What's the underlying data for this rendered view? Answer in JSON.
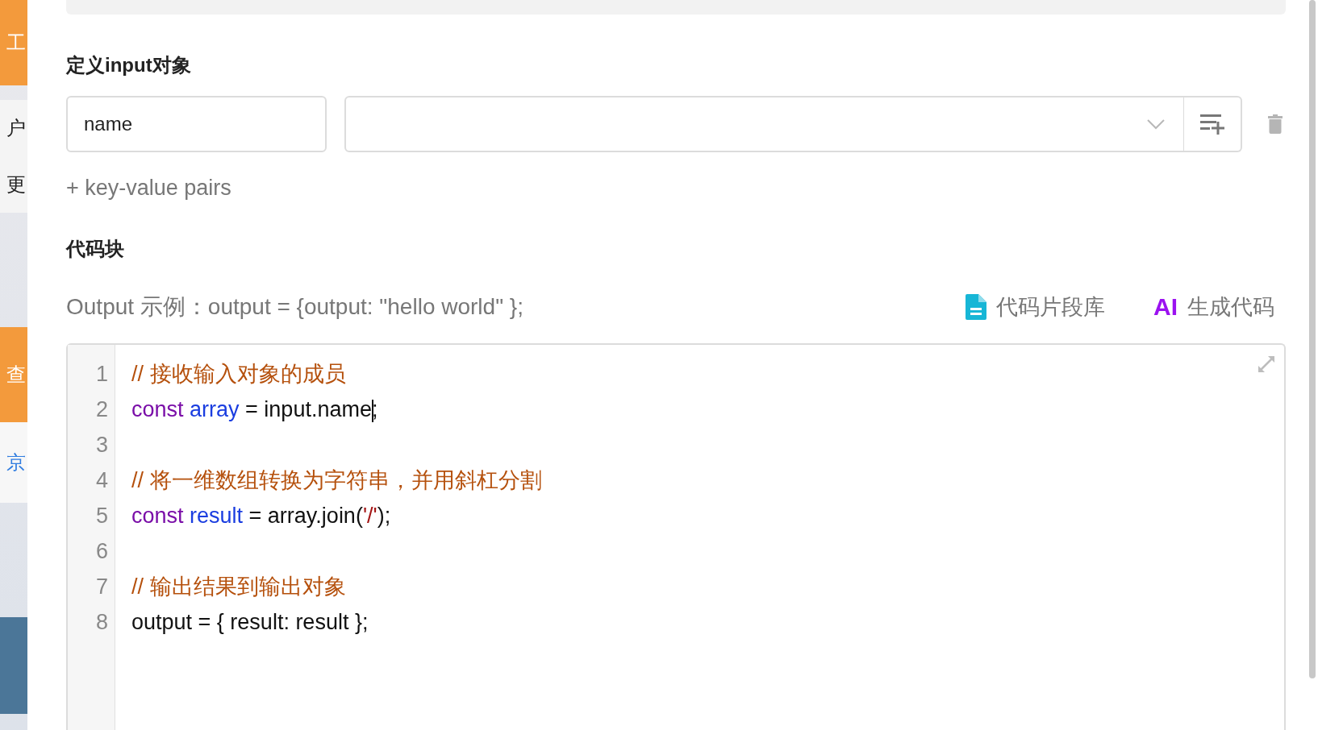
{
  "side_strip": [
    {
      "text": "工",
      "kind": "accent"
    },
    {
      "text": "户",
      "kind": "plain"
    },
    {
      "text": "更",
      "kind": "plain"
    },
    {
      "text": "查",
      "kind": "accent"
    },
    {
      "text": "京",
      "kind": "link"
    },
    {
      "kind": "dark"
    }
  ],
  "input_section": {
    "title": "定义input对象",
    "rows": [
      {
        "key": "name"
      }
    ],
    "add_link": "+ key-value pairs"
  },
  "code_section": {
    "title": "代码块",
    "hint": "Output 示例：output = {output: \"hello world\" };",
    "snippet_button": "代码片段库",
    "ai_badge": "AI",
    "ai_button": "生成代码",
    "lines": [
      {
        "number": "1",
        "tokens": [
          {
            "kind": "comment",
            "text": "// 接收输入对象的成员"
          }
        ]
      },
      {
        "number": "2",
        "tokens": [
          {
            "kind": "keyword",
            "text": "const"
          },
          {
            "kind": "variable",
            "text": " array"
          },
          {
            "kind": "plain",
            "text": " = input.name",
            "cursor_after": true
          },
          {
            "kind": "plain",
            "text": ";"
          }
        ]
      },
      {
        "number": "3"
      },
      {
        "number": "4",
        "tokens": [
          {
            "kind": "comment",
            "text": "// 将一维数组转换为字符串，并用斜杠分割"
          }
        ]
      },
      {
        "number": "5",
        "tokens": [
          {
            "kind": "keyword",
            "text": "const"
          },
          {
            "kind": "variable",
            "text": " result"
          },
          {
            "kind": "plain",
            "text": " = array.join("
          },
          {
            "kind": "string",
            "text": "'/'"
          },
          {
            "kind": "plain",
            "text": ");"
          }
        ]
      },
      {
        "number": "6"
      },
      {
        "number": "7",
        "tokens": [
          {
            "kind": "comment",
            "text": "// 输出结果到输出对象"
          }
        ]
      },
      {
        "number": "8",
        "tokens": [
          {
            "kind": "plain",
            "text": "output = { result: result };"
          }
        ]
      }
    ]
  }
}
